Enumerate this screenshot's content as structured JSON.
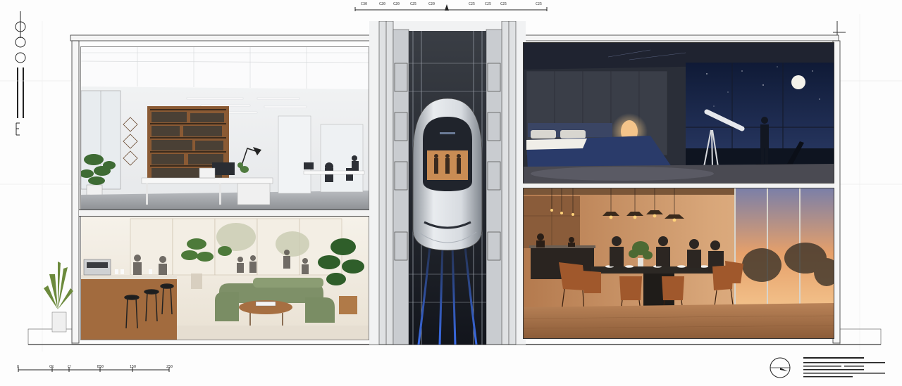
{
  "top_scale": {
    "labels": [
      "C30",
      "C20",
      "C20",
      "C25",
      "C20",
      "C25",
      "C25",
      "C25",
      "C25"
    ]
  },
  "bottom_scale": {
    "labels": [
      "0",
      "CR",
      "C!",
      "B50",
      "150",
      "250"
    ]
  },
  "left_legend": {
    "symbols": [
      "circle-line-symbol",
      "circle-symbol",
      "circle-symbol",
      "double-bar-symbol",
      "e-mark-symbol"
    ]
  },
  "scenes": {
    "office": "office-interior",
    "lounge": "lounge-interior",
    "elevator": "elevator-pod",
    "bedroom": "bedroom-interior",
    "dining": "dining-interior"
  },
  "colors": {
    "bedroom_night": "#1c2540",
    "dining_warm": "#c8865a",
    "office_light": "#eef0f2",
    "lounge_warm": "#efe8dc",
    "elevator_blue": "#3a6ce8"
  }
}
